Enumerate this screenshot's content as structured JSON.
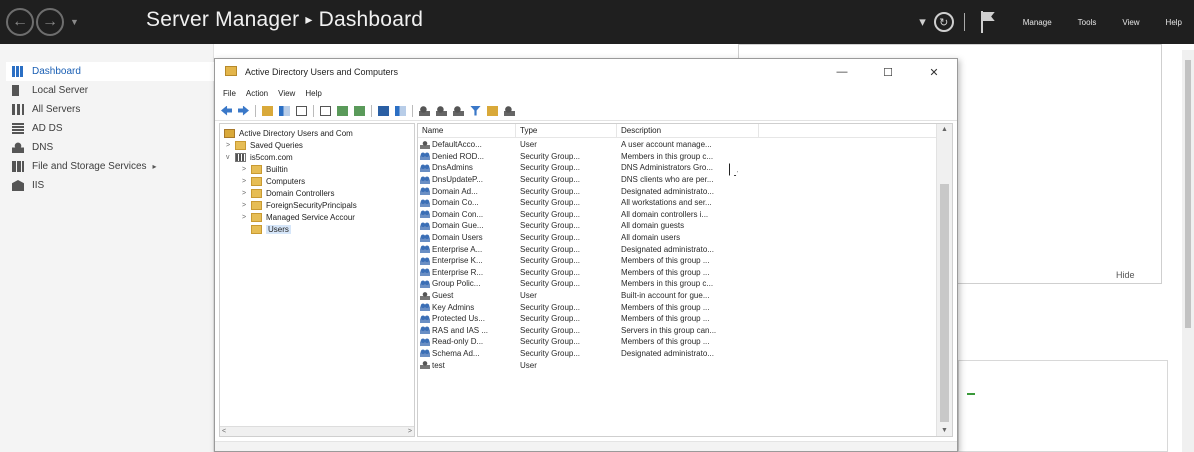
{
  "header": {
    "app": "Server Manager",
    "separator": "▸",
    "page": "Dashboard",
    "menu": [
      "Manage",
      "Tools",
      "View",
      "Help"
    ]
  },
  "nav": {
    "items": [
      {
        "label": "Dashboard",
        "icon": "dashboard-icon",
        "active": true
      },
      {
        "label": "Local Server",
        "icon": "server-icon"
      },
      {
        "label": "All Servers",
        "icon": "servers-icon"
      },
      {
        "label": "AD DS",
        "icon": "adds-icon"
      },
      {
        "label": "DNS",
        "icon": "dns-icon"
      },
      {
        "label": "File and Storage Services",
        "icon": "storage-icon",
        "arrow": "▸"
      },
      {
        "label": "IIS",
        "icon": "iis-icon"
      }
    ]
  },
  "dashboard": {
    "hide_label": "Hide"
  },
  "aduc": {
    "title": "Active Directory Users and Computers",
    "menu": [
      "File",
      "Action",
      "View",
      "Help"
    ],
    "window_buttons": {
      "minimize": "—",
      "maximize": "☐",
      "close": "✕"
    },
    "tree": {
      "root": "Active Directory Users and Com",
      "items": [
        {
          "label": "Saved Queries",
          "indent": 1,
          "exp": ">"
        },
        {
          "label": "is5com.com",
          "indent": 1,
          "exp": "v",
          "kind": "domain"
        },
        {
          "label": "Builtin",
          "indent": 2,
          "exp": ">"
        },
        {
          "label": "Computers",
          "indent": 2,
          "exp": ">"
        },
        {
          "label": "Domain Controllers",
          "indent": 2,
          "exp": ">"
        },
        {
          "label": "ForeignSecurityPrincipals",
          "indent": 2,
          "exp": ">"
        },
        {
          "label": "Managed Service Accour",
          "indent": 2,
          "exp": ">"
        },
        {
          "label": "Users",
          "indent": 2,
          "exp": "",
          "selected": true
        }
      ]
    },
    "columns": {
      "name": "Name",
      "type": "Type",
      "description": "Description"
    },
    "rows": [
      {
        "name": "DefaultAcco...",
        "type": "User",
        "desc": "A user account manage...",
        "kind": "user"
      },
      {
        "name": "Denied ROD...",
        "type": "Security Group...",
        "desc": "Members in this group c...",
        "kind": "group"
      },
      {
        "name": "DnsAdmins",
        "type": "Security Group...",
        "desc": "DNS Administrators Gro...",
        "kind": "group"
      },
      {
        "name": "DnsUpdateP...",
        "type": "Security Group...",
        "desc": "DNS clients who are per...",
        "kind": "group"
      },
      {
        "name": "Domain Ad...",
        "type": "Security Group...",
        "desc": "Designated administrato...",
        "kind": "group"
      },
      {
        "name": "Domain Co...",
        "type": "Security Group...",
        "desc": "All workstations and ser...",
        "kind": "group"
      },
      {
        "name": "Domain Con...",
        "type": "Security Group...",
        "desc": "All domain controllers i...",
        "kind": "group"
      },
      {
        "name": "Domain Gue...",
        "type": "Security Group...",
        "desc": "All domain guests",
        "kind": "group"
      },
      {
        "name": "Domain Users",
        "type": "Security Group...",
        "desc": "All domain users",
        "kind": "group"
      },
      {
        "name": "Enterprise A...",
        "type": "Security Group...",
        "desc": "Designated administrato...",
        "kind": "group"
      },
      {
        "name": "Enterprise K...",
        "type": "Security Group...",
        "desc": "Members of this group ...",
        "kind": "group"
      },
      {
        "name": "Enterprise R...",
        "type": "Security Group...",
        "desc": "Members of this group ...",
        "kind": "group"
      },
      {
        "name": "Group Polic...",
        "type": "Security Group...",
        "desc": "Members in this group c...",
        "kind": "group"
      },
      {
        "name": "Guest",
        "type": "User",
        "desc": "Built-in account for gue...",
        "kind": "user"
      },
      {
        "name": "Key Admins",
        "type": "Security Group...",
        "desc": "Members of this group ...",
        "kind": "group"
      },
      {
        "name": "Protected Us...",
        "type": "Security Group...",
        "desc": "Members of this group ...",
        "kind": "group"
      },
      {
        "name": "RAS and IAS ...",
        "type": "Security Group...",
        "desc": "Servers in this group can...",
        "kind": "group"
      },
      {
        "name": "Read-only D...",
        "type": "Security Group...",
        "desc": "Members of this group ...",
        "kind": "group"
      },
      {
        "name": "Schema Ad...",
        "type": "Security Group...",
        "desc": "Designated administrato...",
        "kind": "group"
      },
      {
        "name": "test",
        "type": "User",
        "desc": "",
        "kind": "user"
      }
    ]
  },
  "colors": {
    "header_bg": "#1f1f1f",
    "active_nav_text": "#1a5fb4",
    "selection": "#d6e6f9"
  }
}
